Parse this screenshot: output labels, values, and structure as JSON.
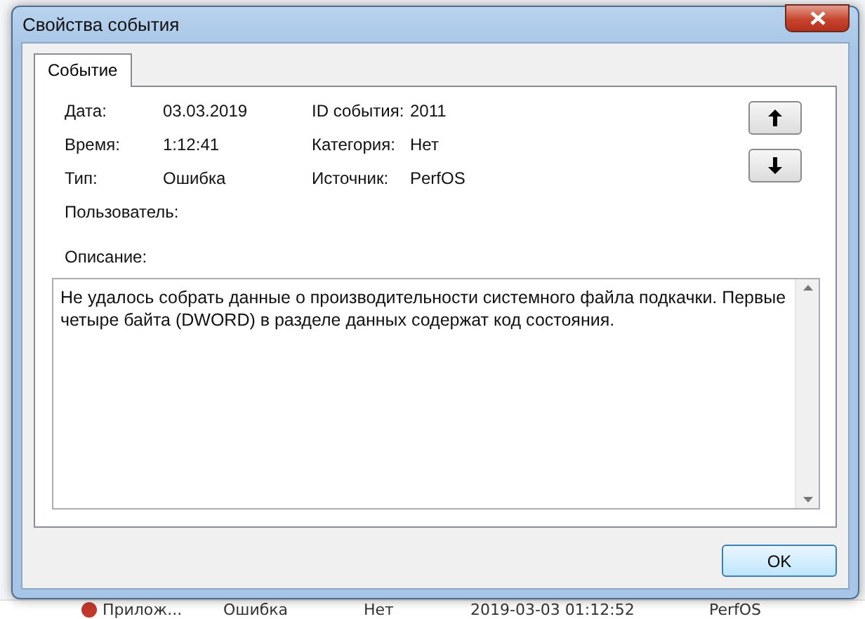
{
  "background_list": {
    "row": {
      "cells": [
        "Прилож...",
        "Ошибка",
        "Нет",
        "2019-03-03 01:12:52",
        "PerfOS"
      ]
    }
  },
  "window": {
    "title": "Свойства события"
  },
  "tabs": [
    {
      "label": "Событие",
      "selected": true
    }
  ],
  "fields": [
    {
      "label": "Дата:",
      "value": "03.03.2019"
    },
    {
      "label": "ID события:",
      "value": "2011"
    },
    {
      "label": "Время:",
      "value": "1:12:41"
    },
    {
      "label": "Категория:",
      "value": "Нет"
    },
    {
      "label": "Тип:",
      "value": "Ошибка"
    },
    {
      "label": "Источник:",
      "value": "PerfOS"
    },
    {
      "label": "Пользователь:"
    }
  ],
  "description": {
    "label": "Описание:",
    "text": "Не удалось собрать данные о производительности системного файла подкачки. Первые четыре байта (DWORD) в разделе данных содержат код состояния."
  },
  "buttons": [
    "OK"
  ]
}
